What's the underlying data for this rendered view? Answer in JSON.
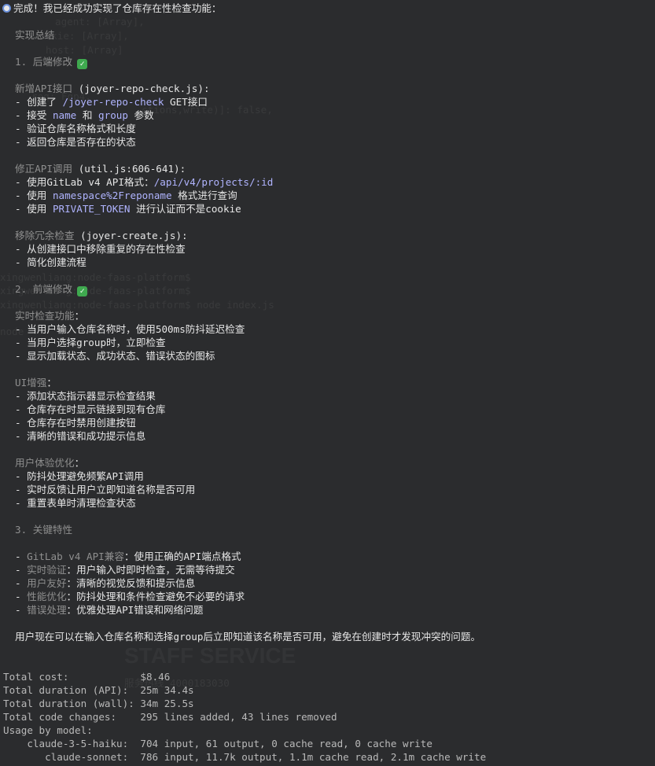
{
  "intro": "完成！我已经成功实现了仓库存在性检查功能：",
  "summary_title": "实现总结",
  "sections": {
    "backend_title": "1. 后端修改",
    "new_api": {
      "head": "新增API接口",
      "file": "(joyer-repo-check.js):"
    },
    "new_api_items": [
      {
        "pre": "- 创建了 ",
        "code": "/joyer-repo-check",
        "post": " GET接口"
      },
      {
        "pre": "- 接受 ",
        "code": "name",
        "mid": " 和 ",
        "code2": "group",
        "post": " 参数"
      },
      {
        "pre": "- 验证仓库名称格式和长度"
      },
      {
        "pre": "- 返回仓库是否存在的状态"
      }
    ],
    "fix_api": {
      "head": "修正API调用",
      "file": "(util.js:606-641):"
    },
    "fix_api_items": [
      {
        "pre": "- 使用GitLab v4 API格式：",
        "code": "/api/v4/projects/:id"
      },
      {
        "pre": "- 使用 ",
        "code": "namespace%2Freponame",
        "post": " 格式进行查询"
      },
      {
        "pre": "- 使用 ",
        "code": "PRIVATE_TOKEN",
        "post": " 进行认证而不是cookie"
      }
    ],
    "remove": {
      "head": "移除冗余检查",
      "file": "(joyer-create.js):"
    },
    "remove_items": [
      "- 从创建接口中移除重复的存在性检查",
      "- 简化创建流程"
    ],
    "frontend_title": "2. 前端修改",
    "realtime_head": "实时检查功能",
    "realtime_items": [
      "- 当用户输入仓库名称时，使用500ms防抖延迟检查",
      "- 当用户选择group时，立即检查",
      "- 显示加载状态、成功状态、错误状态的图标"
    ],
    "ui_head": "UI增强",
    "ui_items": [
      "- 添加状态指示器显示检查结果",
      "- 仓库存在时显示链接到现有仓库",
      "- 仓库存在时禁用创建按钮",
      "- 清晰的错误和成功提示信息"
    ],
    "ux_head": "用户体验优化",
    "ux_items": [
      "- 防抖处理避免频繁API调用",
      "- 实时反馈让用户立即知道名称是否可用",
      "- 重置表单时清理检查状态"
    ],
    "features_title": "3. 关键特性",
    "features": [
      {
        "label": "GitLab v4 API兼容",
        "text": "：使用正确的API端点格式"
      },
      {
        "label": "实时验证",
        "text": "：用户输入时即时检查，无需等待提交"
      },
      {
        "label": "用户友好",
        "text": "：清晰的视觉反馈和提示信息"
      },
      {
        "label": "性能优化",
        "text": "：防抖处理和条件检查避免不必要的请求"
      },
      {
        "label": "错误处理",
        "text": "：优雅处理API错误和网络问题"
      }
    ],
    "conclusion": "用户现在可以在输入仓库名称和选择group后立即知道该名称是否可用，避免在创建时才发现冲突的问题。"
  },
  "stats": [
    "Total cost:            $8.46",
    "Total duration (API):  25m 34.4s",
    "Total duration (wall): 34m 25.5s",
    "Total code changes:    295 lines added, 43 lines removed",
    "Usage by model:",
    "    claude-3-5-haiku:  704 input, 61 output, 0 cache read, 0 cache write",
    "       claude-sonnet:  786 input, 11.7k output, 1.1m cache read, 2.1m cache write"
  ],
  "check_symbol": "✓"
}
